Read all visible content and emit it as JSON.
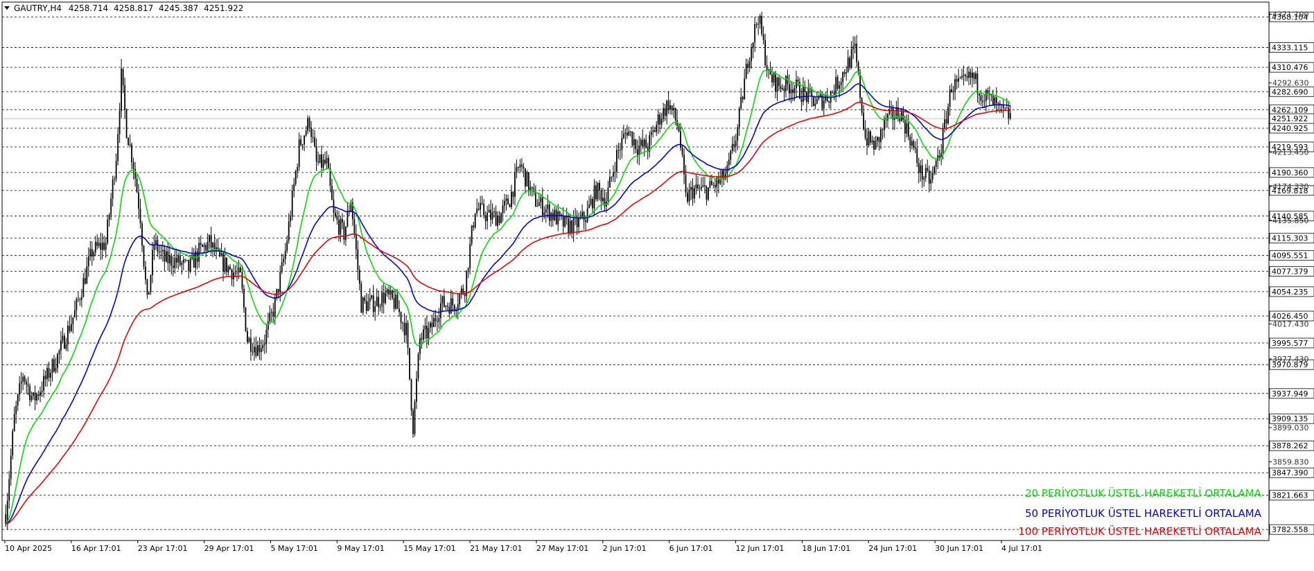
{
  "chart_data": {
    "type": "candlestick",
    "symbol": "GAUTRY",
    "timeframe": "H4",
    "ohlc_header": [
      "4258.714",
      "4258.817",
      "4245.387",
      "4251.922"
    ],
    "y_range": [
      3770,
      4385
    ],
    "current_price": 4251.922,
    "grid_levels": [
      4368.104,
      4333.115,
      4310.476,
      4282.69,
      4262.109,
      4240.925,
      4219.593,
      4190.36,
      4169.818,
      4140.585,
      4115.303,
      4095.551,
      4077.379,
      4054.235,
      4026.45,
      3995.577,
      3970.879,
      3937.949,
      3909.135,
      3878.262,
      3847.39,
      3821.663,
      3782.558
    ],
    "grid_labels": [
      "4368.104",
      "4333.115",
      "4310.476",
      "4282.690",
      "4262.109",
      "4240.925",
      "4219.593",
      "4190.360",
      "4169.818",
      "4140.585",
      "4115.303",
      "4095.551",
      "4077.379",
      "4054.235",
      "4026.450",
      "3995.577",
      "3970.879",
      "3937.949",
      "3909.135",
      "3878.262",
      "3847.390",
      "3821.663",
      "3782.558"
    ],
    "minor_levels": [
      4371.1,
      4292.63,
      4213.45,
      4174.33,
      4135.85,
      4017.43,
      3977.43,
      3899.03,
      3859.83
    ],
    "minor_labels": [
      "4371.100",
      "4292.630",
      "4213.450",
      "4174.330",
      "4135.850",
      "4017.430",
      "3977.430",
      "3899.030",
      "3859.830"
    ],
    "current_label": "4251.922",
    "x_labels": [
      "10 Apr 2025",
      "16 Apr 17:01",
      "23 Apr 17:01",
      "29 Apr 17:01",
      "5 May 17:01",
      "9 May 17:01",
      "15 May 17:01",
      "21 May 17:01",
      "27 May 17:01",
      "2 Jun 17:01",
      "6 Jun 17:01",
      "12 Jun 17:01",
      "18 Jun 17:01",
      "24 Jun 17:01",
      "30 Jun 17:01",
      "4 Jul 17:01"
    ],
    "anchors": [
      [
        0,
        3800
      ],
      [
        5,
        3910
      ],
      [
        10,
        3960
      ],
      [
        16,
        3930
      ],
      [
        22,
        3950
      ],
      [
        30,
        3980
      ],
      [
        40,
        4030
      ],
      [
        50,
        4100
      ],
      [
        58,
        4110
      ],
      [
        64,
        4210
      ],
      [
        67,
        4300
      ],
      [
        70,
        4240
      ],
      [
        74,
        4200
      ],
      [
        78,
        4140
      ],
      [
        82,
        4040
      ],
      [
        86,
        4110
      ],
      [
        92,
        4090
      ],
      [
        98,
        4090
      ],
      [
        106,
        4080
      ],
      [
        112,
        4100
      ],
      [
        118,
        4110
      ],
      [
        124,
        4090
      ],
      [
        130,
        4080
      ],
      [
        136,
        4070
      ],
      [
        140,
        4000
      ],
      [
        146,
        3990
      ],
      [
        150,
        4000
      ],
      [
        156,
        4040
      ],
      [
        162,
        4100
      ],
      [
        170,
        4220
      ],
      [
        176,
        4250
      ],
      [
        180,
        4200
      ],
      [
        186,
        4200
      ],
      [
        190,
        4140
      ],
      [
        196,
        4120
      ],
      [
        200,
        4160
      ],
      [
        206,
        4040
      ],
      [
        212,
        4040
      ],
      [
        220,
        4050
      ],
      [
        226,
        4040
      ],
      [
        232,
        4010
      ],
      [
        236,
        3900
      ],
      [
        240,
        4000
      ],
      [
        246,
        4010
      ],
      [
        252,
        4040
      ],
      [
        260,
        4040
      ],
      [
        266,
        4060
      ],
      [
        272,
        4150
      ],
      [
        280,
        4140
      ],
      [
        286,
        4140
      ],
      [
        292,
        4160
      ],
      [
        298,
        4200
      ],
      [
        306,
        4160
      ],
      [
        312,
        4150
      ],
      [
        318,
        4140
      ],
      [
        324,
        4130
      ],
      [
        330,
        4130
      ],
      [
        336,
        4140
      ],
      [
        342,
        4170
      ],
      [
        348,
        4160
      ],
      [
        354,
        4210
      ],
      [
        360,
        4240
      ],
      [
        366,
        4220
      ],
      [
        372,
        4220
      ],
      [
        378,
        4250
      ],
      [
        384,
        4270
      ],
      [
        390,
        4240
      ],
      [
        394,
        4160
      ],
      [
        398,
        4170
      ],
      [
        406,
        4170
      ],
      [
        414,
        4180
      ],
      [
        418,
        4190
      ],
      [
        424,
        4240
      ],
      [
        430,
        4320
      ],
      [
        436,
        4370
      ],
      [
        442,
        4300
      ],
      [
        448,
        4290
      ],
      [
        456,
        4290
      ],
      [
        462,
        4280
      ],
      [
        470,
        4270
      ],
      [
        478,
        4280
      ],
      [
        484,
        4300
      ],
      [
        492,
        4330
      ],
      [
        498,
        4230
      ],
      [
        504,
        4220
      ],
      [
        510,
        4250
      ],
      [
        518,
        4260
      ],
      [
        524,
        4230
      ],
      [
        530,
        4190
      ],
      [
        536,
        4180
      ],
      [
        542,
        4220
      ],
      [
        548,
        4290
      ],
      [
        554,
        4290
      ],
      [
        560,
        4300
      ],
      [
        566,
        4280
      ],
      [
        572,
        4270
      ],
      [
        576,
        4260
      ],
      [
        582,
        4255
      ]
    ],
    "legend": [
      {
        "label": "20 PERİYOTLUK ÜSTEL HAREKETLİ ORTALAMA",
        "color": "#00e000",
        "period": 20
      },
      {
        "label": "50 PERİYOTLUK ÜSTEL HAREKETLİ ORTALAMA",
        "color": "#0000e0",
        "period": 50
      },
      {
        "label": "100 PERİYOTLUK ÜSTEL HAREKETLİ ORTALAMA",
        "color": "#ee0000",
        "period": 100
      }
    ],
    "colors": {
      "candle": "#000000",
      "grid": "#000000",
      "current_line": "#c0c0c0"
    }
  }
}
